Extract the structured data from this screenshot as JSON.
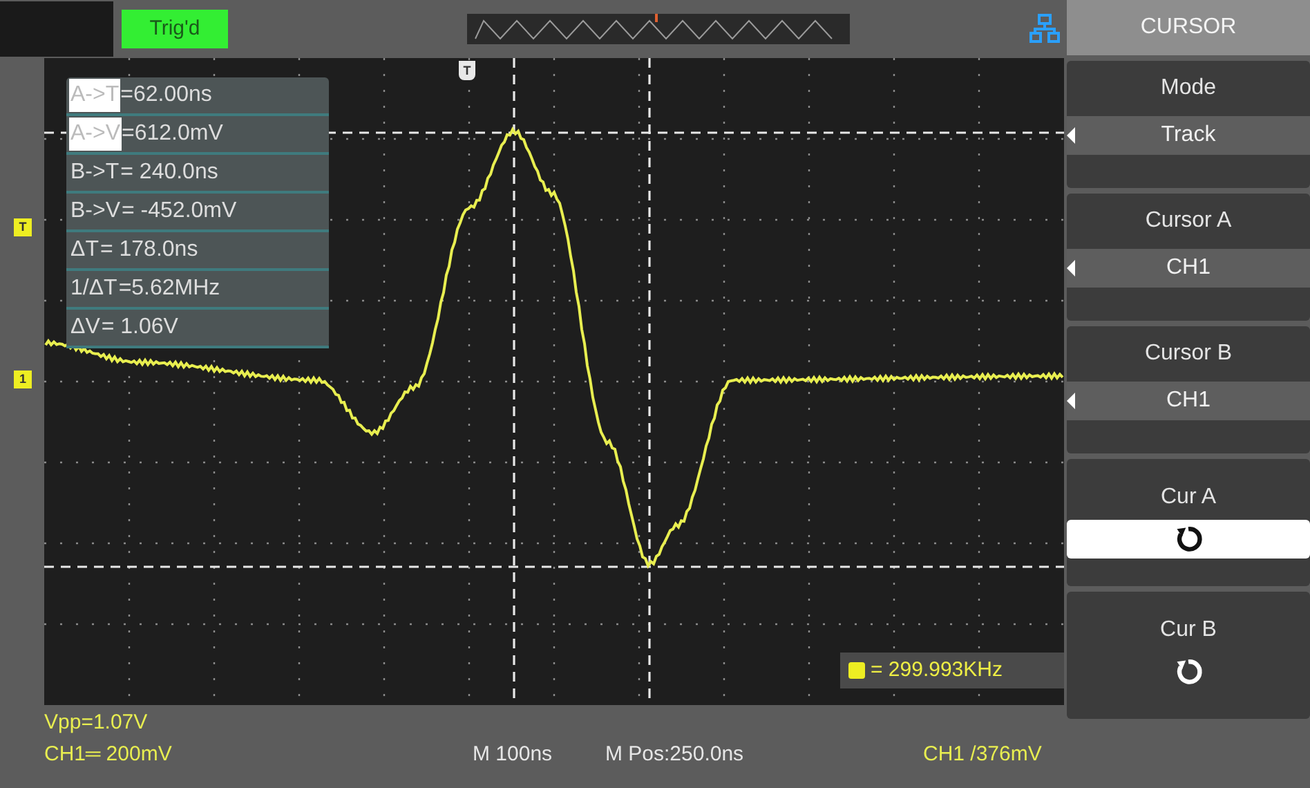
{
  "top_bar": {
    "trigger_status": "Trig'd"
  },
  "markers": {
    "trigger_position": "T",
    "trigger_level": "T",
    "channel": "1"
  },
  "cursor_readouts": [
    {
      "label": "A->T",
      "value": "=62.00ns",
      "highlighted": true
    },
    {
      "label": "A->V",
      "value": "=612.0mV",
      "highlighted": true
    },
    {
      "label": "B->T",
      "value": " = 240.0ns",
      "highlighted": false
    },
    {
      "label": "B->V",
      "value": " = -452.0mV",
      "highlighted": false
    },
    {
      "label": "ΔT",
      "value": " = 178.0ns",
      "highlighted": false
    },
    {
      "label": "1/ΔT",
      "value": " =5.62MHz",
      "highlighted": false
    },
    {
      "label": "ΔV",
      "value": " = 1.06V",
      "highlighted": false
    }
  ],
  "frequency": {
    "value": "= 299.993KHz"
  },
  "menu": {
    "title": "CURSOR",
    "items": [
      {
        "kind": "option",
        "label": "Mode",
        "value": "Track"
      },
      {
        "kind": "option",
        "label": "Cursor A",
        "value": "CH1"
      },
      {
        "kind": "option",
        "label": "Cursor B",
        "value": "CH1"
      },
      {
        "kind": "knob",
        "label": "Cur A",
        "selected": true
      },
      {
        "kind": "knob",
        "label": "Cur B",
        "selected": false
      }
    ]
  },
  "status_bar": {
    "vpp": "Vpp=1.07V",
    "channel_scale": "CH1═ 200mV",
    "timebase": "M 100ns",
    "position": "M Pos:250.0ns",
    "trigger": "CH1 /376mV"
  }
}
